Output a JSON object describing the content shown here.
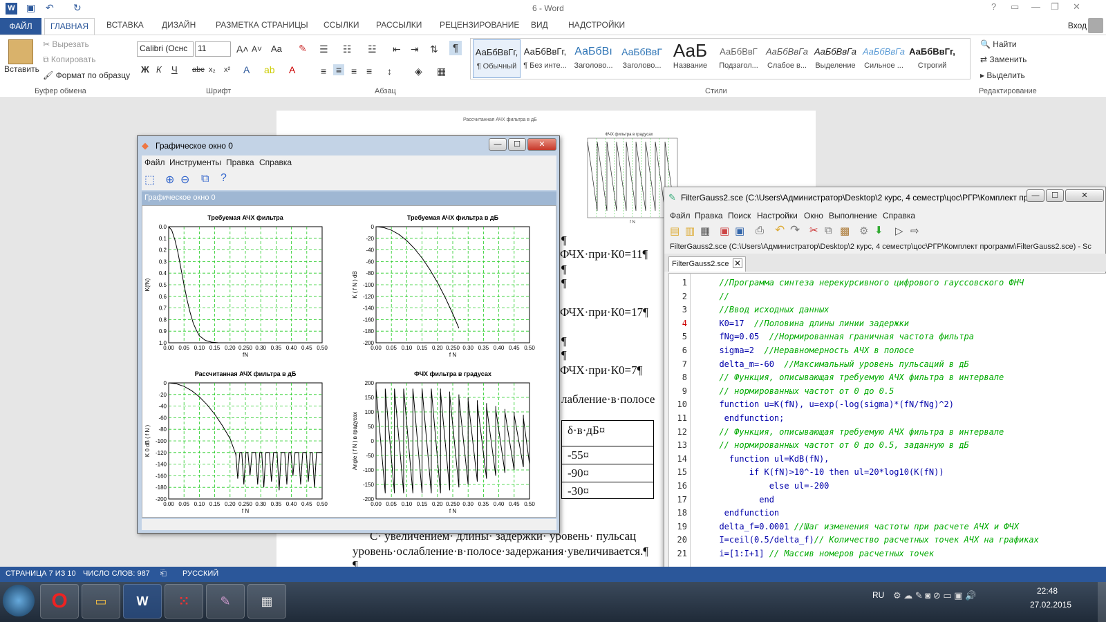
{
  "word": {
    "title": "6 - Word",
    "tabs": [
      "ФАЙЛ",
      "ГЛАВНАЯ",
      "ВСТАВКА",
      "ДИЗАЙН",
      "РАЗМЕТКА СТРАНИЦЫ",
      "ССЫЛКИ",
      "РАССЫЛКИ",
      "РЕЦЕНЗИРОВАНИЕ",
      "ВИД",
      "НАДСТРОЙКИ"
    ],
    "login": "Вход",
    "clipboard": {
      "paste": "Вставить",
      "cut": "Вырезать",
      "copy": "Копировать",
      "format": "Формат по образцу",
      "group": "Буфер обмена"
    },
    "font": {
      "name": "Calibri (Оснс",
      "size": "11",
      "group": "Шрифт"
    },
    "paragraph_group": "Абзац",
    "styles": [
      {
        "sample": "АаБбВвГг,",
        "name": "¶ Обычный"
      },
      {
        "sample": "АаБбВвГг,",
        "name": "¶ Без инте..."
      },
      {
        "sample": "АаБбВı",
        "name": "Заголово..."
      },
      {
        "sample": "АаБбВвГ",
        "name": "Заголово..."
      },
      {
        "sample": "АаБ",
        "name": "Название"
      },
      {
        "sample": "АаБбВвГ",
        "name": "Подзагол..."
      },
      {
        "sample": "АаБбВвГа",
        "name": "Слабое в..."
      },
      {
        "sample": "АаБбВвГа",
        "name": "Выделение"
      },
      {
        "sample": "АаБбВвГа",
        "name": "Сильное ..."
      },
      {
        "sample": "АаБбВвГг,",
        "name": "Строгий"
      }
    ],
    "styles_group": "Стили",
    "editing": {
      "find": "Найти",
      "replace": "Заменить",
      "select": "Выделить",
      "group": "Редактирование"
    },
    "status": {
      "page": "СТРАНИЦА 7 ИЗ 10",
      "words": "ЧИСЛО СЛОВ: 987",
      "lang": "РУССКИЙ"
    },
    "doc_lines": [
      "¶",
      "ФЧХ·при·К0=11¶",
      "¶",
      "¶",
      "ФЧХ·при·К0=17¶",
      "¶",
      "¶",
      "ФЧХ·при·К0=7¶",
      "лабление·в·полосе"
    ],
    "table": [
      [
        "δ·в·дБ¤"
      ],
      [
        "-55¤"
      ],
      [
        "-90¤"
      ],
      [
        "-30¤"
      ]
    ],
    "bottom_text": [
      "С· увеличением· длины· задержки· уровень· пульсац",
      "уровень·ослабление·в·полосе·задержания·увеличивается.¶",
      "¶"
    ],
    "embedded_chart_titles": [
      "Рассчитанная АЧХ фильтра в дБ",
      "ФЧХ фильтра в градусах"
    ],
    "embedded_xlabel": "f N",
    "embedded_ylabel": "Angle ( f N ) в градусах"
  },
  "graph_window": {
    "title": "Графическое окно 0",
    "menu": [
      "Файл",
      "Инструменты",
      "Правка",
      "Справка"
    ],
    "caption": "Графическое окно 0"
  },
  "chart_data": [
    {
      "type": "line",
      "title": "Требуемая АЧХ фильтра",
      "xlabel": "fN",
      "ylabel": "K(fN)",
      "xlim": [
        0,
        0.5
      ],
      "ylim": [
        0,
        1
      ],
      "xticks": [
        "0.00",
        "0.05",
        "0.10",
        "0.15",
        "0.20",
        "0.250",
        "0.30",
        "0.35",
        "0.40",
        "0.45",
        "0.50"
      ],
      "yticks": [
        "0.0",
        "0.1",
        "0.2",
        "0.3",
        "0.4",
        "0.5",
        "0.6",
        "0.7",
        "0.8",
        "0.9",
        "1.0"
      ],
      "x": [
        0,
        0.01,
        0.02,
        0.03,
        0.04,
        0.05,
        0.06,
        0.07,
        0.08,
        0.09,
        0.1,
        0.12,
        0.14,
        0.16,
        0.2,
        0.3,
        0.5
      ],
      "y": [
        1,
        0.97,
        0.89,
        0.78,
        0.64,
        0.5,
        0.37,
        0.26,
        0.17,
        0.11,
        0.06,
        0.02,
        0.005,
        0.001,
        0,
        0,
        0
      ],
      "grid": true
    },
    {
      "type": "line",
      "title": "Требуемая АЧХ фильтра в дБ",
      "xlabel": "f N",
      "ylabel": "K ( f N ) dB",
      "xlim": [
        0,
        0.5
      ],
      "ylim": [
        -200,
        0
      ],
      "xticks": [
        "0.00",
        "0.05",
        "0.10",
        "0.15",
        "0.20",
        "0.250",
        "0.30",
        "0.35",
        "0.40",
        "0.45",
        "0.50"
      ],
      "yticks": [
        "0",
        "-20",
        "-40",
        "-60",
        "-80",
        "-100",
        "-120",
        "-140",
        "-160",
        "-180",
        "-200"
      ],
      "x": [
        0,
        0.025,
        0.05,
        0.075,
        0.1,
        0.125,
        0.15,
        0.175,
        0.2,
        0.225,
        0.25,
        0.27
      ],
      "y": [
        0,
        -1.5,
        -6,
        -13.5,
        -24,
        -37.6,
        -54,
        -73.6,
        -96,
        -121.6,
        -150,
        -175
      ],
      "grid": true
    },
    {
      "type": "line",
      "title": "Рассчитанная АЧХ фильтра в дБ",
      "xlabel": "f N",
      "ylabel": "K 0 dB ( f N )",
      "xlim": [
        0,
        0.5
      ],
      "ylim": [
        -200,
        0
      ],
      "xticks": [
        "0.00",
        "0.05",
        "0.10",
        "0.15",
        "0.20",
        "0.250",
        "0.30",
        "0.35",
        "0.40",
        "0.45",
        "0.50"
      ],
      "yticks": [
        "0",
        "-20",
        "-40",
        "-60",
        "-80",
        "-100",
        "-120",
        "-140",
        "-160",
        "-180",
        "-200"
      ],
      "x": [
        0,
        0.025,
        0.05,
        0.075,
        0.1,
        0.125,
        0.15,
        0.175,
        0.2,
        0.22
      ],
      "y": [
        0,
        -1.5,
        -6,
        -13.5,
        -24,
        -37.6,
        -54,
        -73.6,
        -96,
        -125
      ],
      "notch_x": [
        0.225,
        0.245,
        0.265,
        0.29,
        0.31,
        0.335,
        0.36,
        0.385,
        0.405,
        0.43,
        0.455,
        0.475
      ],
      "notch_depth": [
        -165,
        -175,
        -160,
        -175,
        -180,
        -170,
        -185,
        -175,
        -160,
        -175,
        -170,
        -180
      ],
      "ripple_top": -120,
      "grid": true
    },
    {
      "type": "line",
      "title": "ФЧХ фильтра в градусах",
      "xlabel": "f N",
      "ylabel": "Angle ( f N ) в градусах",
      "xlim": [
        0,
        0.5
      ],
      "ylim": [
        -200,
        200
      ],
      "xticks": [
        "0.00",
        "0.05",
        "0.10",
        "0.15",
        "0.20",
        "0.250",
        "0.30",
        "0.35",
        "0.40",
        "0.45",
        "0.50"
      ],
      "yticks": [
        "200",
        "150",
        "100",
        "50",
        "0",
        "-50",
        "-100",
        "-150",
        "-200"
      ],
      "jumps_x": [
        0,
        0.03,
        0.06,
        0.09,
        0.12,
        0.15,
        0.18,
        0.21,
        0.24,
        0.27,
        0.3,
        0.33,
        0.36,
        0.39,
        0.42,
        0.45,
        0.48
      ],
      "grid": true
    }
  ],
  "editor": {
    "title": "FilterGauss2.sce (C:\\Users\\Администратор\\Desktop\\2 курс, 4 семестр\\цос\\РГР\\Комплект пр...",
    "menu": [
      "Файл",
      "Правка",
      "Поиск",
      "Настройки",
      "Окно",
      "Выполнение",
      "Справка"
    ],
    "path": "FilterGauss2.sce (C:\\Users\\Администратор\\Desktop\\2 курс, 4 семестр\\цос\\РГР\\Комплект программ\\FilterGauss2.sce) - Sc",
    "tab": "FilterGauss2.sce",
    "lines": [
      "  //Программа синтеза нерекурсивного цифрового гауссовского ФНЧ",
      "  //",
      "  //Ввод исходных данных",
      "  K0=17  //Половина длины линии задержки",
      "  fNg=0.05  //Нормированная граничная частота фильтра",
      "  sigma=2  //Неравномерность АЧХ в полосе",
      "  delta_m=-60  //Максимальный уровень пульсаций в дБ",
      "  // Функция, описывающая требуемую АЧХ фильтра в интервале",
      "  // нормированных частот от 0 до 0.5",
      "  function u=K(fN), u=exp(-log(sigma)*(fN/fNg)^2)",
      "   endfunction;",
      "  // Функция, описывающая требуемую АЧХ фильтра в интервале",
      "  // нормированных частот от 0 до 0.5, заданную в дБ",
      "    function ul=KdB(fN),",
      "        if K(fN)>10^-10 then ul=20*log10(K(fN))",
      "            else ul=-200",
      "          end",
      "   endfunction",
      "  delta_f=0.0001 //Шаг изменения частоты при расчете АЧХ и ФЧХ",
      "  I=ceil(0.5/delta_f)// Количество расчетных точек АЧХ на графиках",
      "  i=[1:I+1] // Массив номеров расчетных точек"
    ]
  },
  "taskbar": {
    "lang": "RU",
    "time": "22:48",
    "date": "27.02.2015"
  }
}
